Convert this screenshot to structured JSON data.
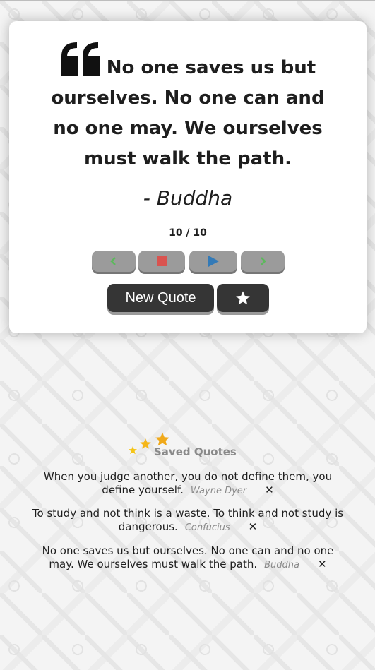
{
  "quote": {
    "text": "No one saves us but ourselves. No one can and no one may. We ourselves must walk the path.",
    "author": "- Buddha",
    "counter": "10 / 10"
  },
  "controls": {
    "prev_icon": "chevron-left-icon",
    "stop_icon": "stop-icon",
    "play_icon": "play-icon",
    "next_icon": "chevron-right-icon",
    "colors": {
      "prev": "#5cb85c",
      "stop": "#d9534f",
      "play": "#337ab7",
      "next": "#5cb85c"
    }
  },
  "actions": {
    "new_quote_label": "New Quote",
    "favorite_icon": "star-icon"
  },
  "saved": {
    "title": "Saved Quotes",
    "items": [
      {
        "text": "When you judge another, you do not define them, you define yourself.",
        "author": "Wayne Dyer",
        "remove": "✕"
      },
      {
        "text": "To study and not think is a waste. To think and not study is dangerous.",
        "author": "Confucius",
        "remove": "✕"
      },
      {
        "text": "No one saves us but ourselves. No one can and no one may. We ourselves must walk the path.",
        "author": "Buddha",
        "remove": "✕"
      }
    ]
  }
}
